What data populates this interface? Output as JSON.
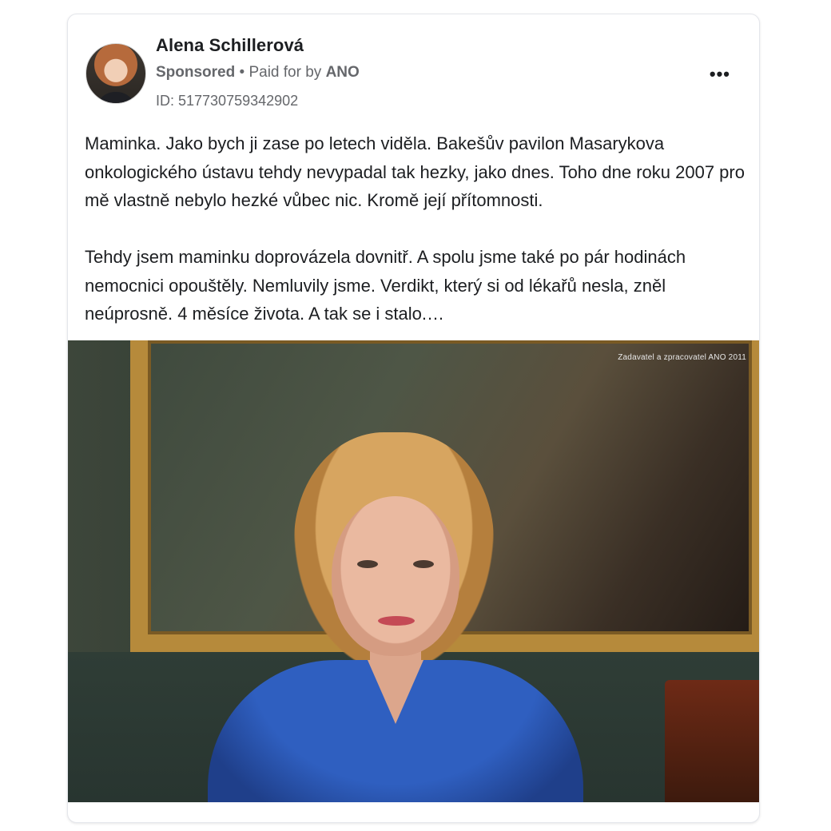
{
  "post": {
    "author_name": "Alena Schillerová",
    "sponsored_label": "Sponsored",
    "separator": " • ",
    "paid_for_prefix": "Paid for by ",
    "payer": "ANO",
    "ad_id": "ID: 517730759342902",
    "more_label": "•••",
    "paragraph_1": "Maminka. Jako bych ji zase po letech viděla. Bakešův pavilon Masarykova onkologického ústavu tehdy nevypadal tak hezky, jako dnes. Toho dne roku 2007 pro mě vlastně nebylo hezké vůbec nic. Kromě její přítomnosti.",
    "paragraph_2": "Tehdy jsem maminku doprovázela dovnitř. A spolu jsme také po pár hodinách nemocnici opouštěly. Nemluvily jsme. Verdikt, který si od lékařů nesla, zněl neúprosně. 4 měsíce života. A tak se i stalo.…",
    "image_watermark": "Zadavatel a zpracovatel ANO 2011"
  }
}
